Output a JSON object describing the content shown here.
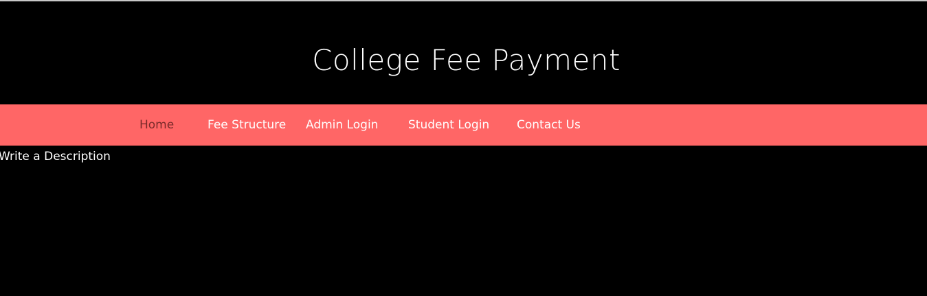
{
  "header": {
    "title": "College Fee Payment"
  },
  "nav": {
    "items": [
      {
        "label": "Home",
        "active": true
      },
      {
        "label": "Fee Structure",
        "active": false
      },
      {
        "label": "Admin Login",
        "active": false
      },
      {
        "label": "Student Login",
        "active": false
      },
      {
        "label": "Contact Us",
        "active": false
      }
    ]
  },
  "main": {
    "description": "Write a Description"
  },
  "colors": {
    "background": "#000000",
    "navbar": "#ff6666",
    "active_link": "#7a2a2a",
    "text": "#ffffff"
  }
}
